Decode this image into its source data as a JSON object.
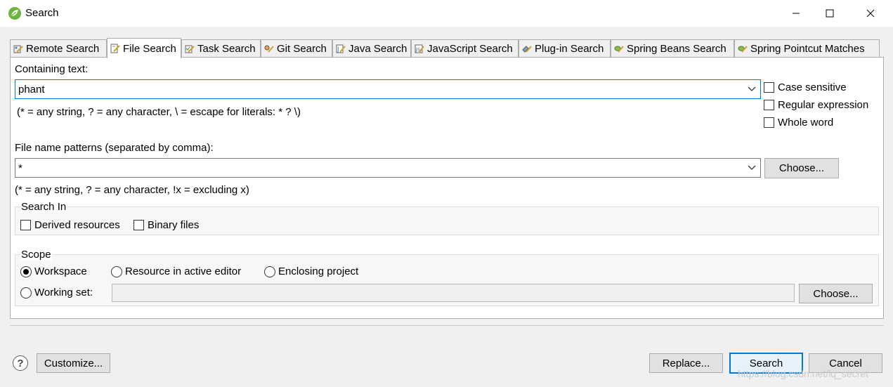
{
  "window": {
    "title": "Search",
    "icon": "spring-leaf-icon"
  },
  "tabs": [
    {
      "label": "Remote Search",
      "icon": "remote-search-icon"
    },
    {
      "label": "File Search",
      "icon": "file-search-icon",
      "active": true
    },
    {
      "label": "Task Search",
      "icon": "task-search-icon"
    },
    {
      "label": "Git Search",
      "icon": "git-search-icon"
    },
    {
      "label": "Java Search",
      "icon": "java-search-icon"
    },
    {
      "label": "JavaScript Search",
      "icon": "javascript-search-icon"
    },
    {
      "label": "Plug-in Search",
      "icon": "plugin-search-icon"
    },
    {
      "label": "Spring Beans Search",
      "icon": "spring-beans-search-icon"
    },
    {
      "label": "Spring Pointcut Matches",
      "icon": "spring-pointcut-icon"
    }
  ],
  "containing_text": {
    "label": "Containing text:",
    "value": "phant",
    "hint": "(* = any string, ? = any character, \\ = escape for literals: * ? \\)"
  },
  "options": {
    "case_sensitive": {
      "label": "Case sensitive",
      "checked": false
    },
    "regular_expression": {
      "label": "Regular expression",
      "checked": false
    },
    "whole_word": {
      "label": "Whole word",
      "checked": false
    }
  },
  "file_patterns": {
    "label": "File name patterns (separated by comma):",
    "value": "*",
    "hint": "(* = any string, ? = any character, !x = excluding x)",
    "choose_label": "Choose..."
  },
  "search_in": {
    "title": "Search In",
    "derived": {
      "label": "Derived resources",
      "checked": false
    },
    "binary": {
      "label": "Binary files",
      "checked": false
    }
  },
  "scope": {
    "title": "Scope",
    "workspace": {
      "label": "Workspace",
      "selected": true
    },
    "active_editor": {
      "label": "Resource in active editor",
      "selected": false
    },
    "enclosing_project": {
      "label": "Enclosing project",
      "selected": false
    },
    "working_set": {
      "label": "Working set:",
      "selected": false,
      "value": ""
    },
    "choose_label": "Choose..."
  },
  "footer": {
    "customize_label": "Customize...",
    "replace_label": "Replace...",
    "search_label": "Search",
    "cancel_label": "Cancel",
    "help_glyph": "?"
  },
  "watermark": "https://blog.csdn.net/lq_secret",
  "colors": {
    "accent": "#0078d7",
    "dialog_bg": "#f0f0f0",
    "panel_bg": "#ffffff"
  }
}
